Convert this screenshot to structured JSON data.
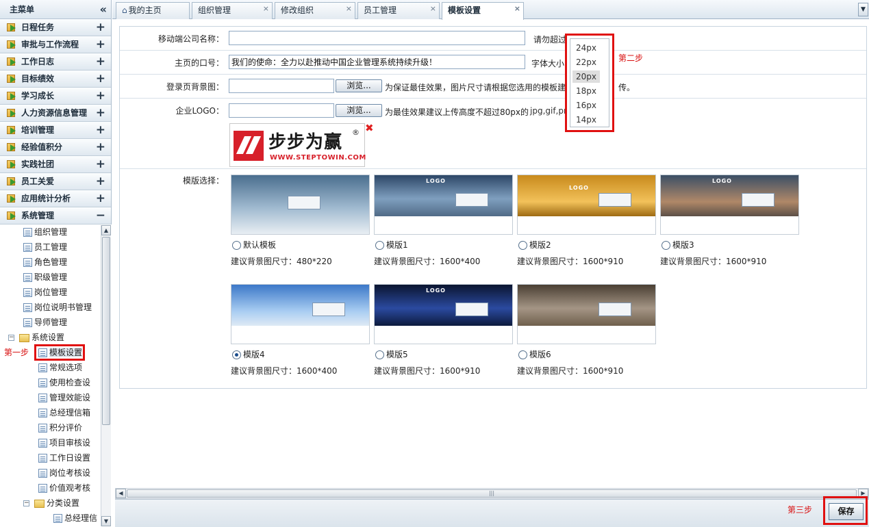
{
  "sidebar": {
    "title": "主菜单",
    "collapse_glyph": "«",
    "items": [
      {
        "label": "日程任务",
        "toggle": "+"
      },
      {
        "label": "审批与工作流程",
        "toggle": "+"
      },
      {
        "label": "工作日志",
        "toggle": "+"
      },
      {
        "label": "目标绩效",
        "toggle": "+"
      },
      {
        "label": "学习成长",
        "toggle": "+"
      },
      {
        "label": "人力资源信息管理",
        "toggle": "+"
      },
      {
        "label": "培训管理",
        "toggle": "+"
      },
      {
        "label": "经验值积分",
        "toggle": "+"
      },
      {
        "label": "实践社团",
        "toggle": "+"
      },
      {
        "label": "员工关爱",
        "toggle": "+"
      },
      {
        "label": "应用统计分析",
        "toggle": "+"
      },
      {
        "label": "系统管理",
        "toggle": "−"
      }
    ],
    "tree": {
      "items": [
        "组织管理",
        "员工管理",
        "角色管理",
        "职级管理",
        "岗位管理",
        "岗位说明书管理",
        "导师管理"
      ],
      "folder": {
        "label": "系统设置",
        "toggle": "−"
      },
      "sub_items": [
        "模板设置",
        "常规选项",
        "使用检查设",
        "管理效能设",
        "总经理信箱",
        "积分评价",
        "项目审核设",
        "工作日设置",
        "岗位考核设",
        "价值观考核"
      ],
      "folder2": {
        "label": "分类设置",
        "toggle": "−"
      },
      "sub_items2": [
        "总经理信"
      ]
    }
  },
  "tabs": [
    {
      "label": "我的主页",
      "icon": "home-icon",
      "closable": false
    },
    {
      "label": "组织管理",
      "closable": true
    },
    {
      "label": "修改组织",
      "closable": true
    },
    {
      "label": "员工管理",
      "closable": true
    },
    {
      "label": "模板设置",
      "closable": true,
      "active": true
    }
  ],
  "tab_close_glyph": "×",
  "form": {
    "mobile_name": {
      "label": "移动端公司名称：",
      "value": "",
      "hint": "请勿超过"
    },
    "slogan": {
      "label": "主页的口号：",
      "value": "我们的使命：全力以赴推动中国企业管理系统持续升级！",
      "hint": "字体大小"
    },
    "login_bg": {
      "label": "登录页背景图：",
      "button": "浏览...",
      "hint": "为保证最佳效果，图片尺寸请根据您选用的模板建",
      "hint2": "传。"
    },
    "logo": {
      "label": "企业LOGO：",
      "button": "浏览...",
      "hint": "为最佳效果建议上传高度不超过80px的",
      "hint_ext": "jpg,gif,png"
    },
    "logo_image": {
      "brand": "步步为赢",
      "reg": "®",
      "url_text": "WWW.STEPTOWIN.COM"
    },
    "delete_glyph": "✖",
    "template_label": "模版选择：",
    "templates": [
      {
        "name": "默认模板",
        "size": "建议背景图尺寸：480*220",
        "selected": false,
        "logo_text": ""
      },
      {
        "name": "模版1",
        "size": "建议背景图尺寸：1600*400",
        "selected": false,
        "logo_text": "LOGO"
      },
      {
        "name": "模版2",
        "size": "建议背景图尺寸：1600*910",
        "selected": false,
        "logo_text": "LOGO"
      },
      {
        "name": "模版3",
        "size": "建议背景图尺寸：1600*910",
        "selected": false,
        "logo_text": "LOGO"
      },
      {
        "name": "模版4",
        "size": "建议背景图尺寸：1600*400",
        "selected": true,
        "logo_text": ""
      },
      {
        "name": "模版5",
        "size": "建议背景图尺寸：1600*910",
        "selected": false,
        "logo_text": "LOGO"
      },
      {
        "name": "模版6",
        "size": "建议背景图尺寸：1600*910",
        "selected": false,
        "logo_text": ""
      }
    ]
  },
  "font_size_dropdown": {
    "options": [
      "24px",
      "22px",
      "20px",
      "18px",
      "16px",
      "14px"
    ],
    "selected": "20px"
  },
  "annotations": {
    "step1": "第一步",
    "step2": "第二步",
    "step3": "第三步"
  },
  "footer": {
    "save_label": "保存"
  },
  "scrollbar": {
    "grip": "|||",
    "left": "◀",
    "right": "▶",
    "up": "▲",
    "down": "▼"
  },
  "colors": {
    "annotation_red": "#e01010",
    "selected_radio": "#1b4c8c"
  }
}
